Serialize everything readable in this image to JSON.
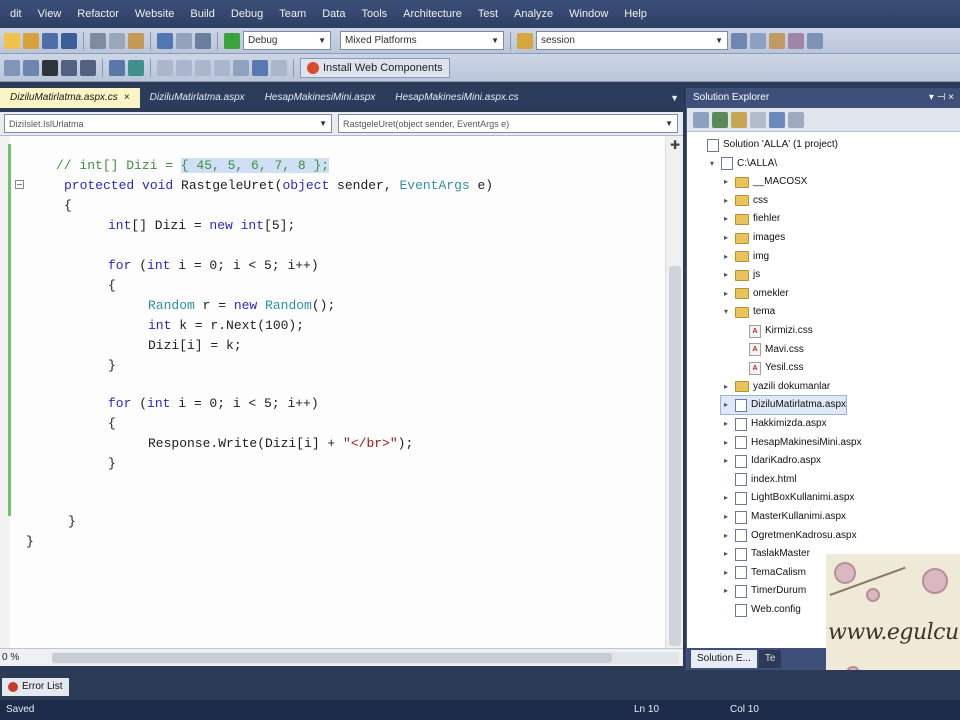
{
  "menu": [
    "dit",
    "View",
    "Refactor",
    "Website",
    "Build",
    "Debug",
    "Team",
    "Data",
    "Tools",
    "Architecture",
    "Test",
    "Analyze",
    "Window",
    "Help"
  ],
  "toolbar": {
    "config": "Debug",
    "platform": "Mixed Platforms",
    "find": "session",
    "install_web_components": "Install Web Components"
  },
  "tabs": [
    {
      "label": "DiziluMatirlatma.aspx.cs",
      "active": true
    },
    {
      "label": "DiziluMatirlatma.aspx",
      "active": false
    },
    {
      "label": "HesapMakinesiMini.aspx",
      "active": false
    },
    {
      "label": "HesapMakinesiMini.aspx.cs",
      "active": false
    }
  ],
  "navbar": {
    "class_combo": "DiziIslet.IslUrlatma",
    "method_combo": "RastgeleUret(object sender, EventArgs e)"
  },
  "code": {
    "comment_prefix": "// int[] Dizi = ",
    "comment_highlight": "{ 45, 5, 6, 7, 8 };",
    "sig_kw": "protected void",
    "sig_name": " RastgeleUret(",
    "sig_kw2": "object",
    "sig_mid": " sender, ",
    "sig_type": "EventArgs",
    "sig_end": " e)",
    "open_brace": "{",
    "close_brace": "}",
    "decl_kw": "int",
    "decl_mid": "[] Dizi = ",
    "decl_new": "new",
    "decl_int": " int",
    "decl_end": "[5];",
    "for1_kw": "for",
    "for1_open": " (",
    "for1_int": "int",
    "for1_rest": " i = 0; i < 5; i++)",
    "rand_type": "Random",
    "rand_mid": " r = ",
    "rand_new": "new",
    "rand_type2": " Random",
    "rand_end": "();",
    "next_kw": "int",
    "next_rest": " k = r.Next(100);",
    "assign": "Dizi[i] = k;",
    "for2_kw": "for",
    "for2_open": " (",
    "for2_int": "int",
    "for2_rest": " i = 0; i < 5; i++)",
    "write_pre": "Response.Write(Dizi[i] + ",
    "write_str": "\"</br>\"",
    "write_end": ");"
  },
  "editor": {
    "zoom": "0 %"
  },
  "solution_explorer": {
    "title": "Solution Explorer",
    "nodes": [
      {
        "label": "Solution 'ALLA' (1 project)",
        "icon": "solution",
        "indent": 0,
        "exp": ""
      },
      {
        "label": "C:\\ALLA\\",
        "icon": "project",
        "indent": 1,
        "exp": "▾"
      },
      {
        "label": "__MACOSX",
        "icon": "folder",
        "indent": 2,
        "exp": "▸"
      },
      {
        "label": "css",
        "icon": "folder",
        "indent": 2,
        "exp": "▸"
      },
      {
        "label": "fiehler",
        "icon": "folder",
        "indent": 2,
        "exp": "▸"
      },
      {
        "label": "images",
        "icon": "folder",
        "indent": 2,
        "exp": "▸"
      },
      {
        "label": "img",
        "icon": "folder",
        "indent": 2,
        "exp": "▸"
      },
      {
        "label": "js",
        "icon": "folder",
        "indent": 2,
        "exp": "▸"
      },
      {
        "label": "omekler",
        "icon": "folder",
        "indent": 2,
        "exp": "▸"
      },
      {
        "label": "tema",
        "icon": "folder",
        "indent": 2,
        "exp": "▾"
      },
      {
        "label": "Kirmizi.css",
        "icon": "css",
        "indent": 3,
        "exp": ""
      },
      {
        "label": "Mavi.css",
        "icon": "css",
        "indent": 3,
        "exp": ""
      },
      {
        "label": "Yesil.css",
        "icon": "css",
        "indent": 3,
        "exp": ""
      },
      {
        "label": "yazili dokumanlar",
        "icon": "folder",
        "indent": 2,
        "exp": "▸"
      },
      {
        "label": "DiziluMatirlatma.aspx",
        "icon": "page",
        "indent": 2,
        "exp": "▸",
        "selected": true
      },
      {
        "label": "Hakkimizda.aspx",
        "icon": "page",
        "indent": 2,
        "exp": "▸"
      },
      {
        "label": "HesapMakinesiMini.aspx",
        "icon": "page",
        "indent": 2,
        "exp": "▸"
      },
      {
        "label": "IdariKadro.aspx",
        "icon": "page",
        "indent": 2,
        "exp": "▸"
      },
      {
        "label": "index.html",
        "icon": "page",
        "indent": 2,
        "exp": ""
      },
      {
        "label": "LightBoxKullanimi.aspx",
        "icon": "page",
        "indent": 2,
        "exp": "▸"
      },
      {
        "label": "MasterKullanimi.aspx",
        "icon": "page",
        "indent": 2,
        "exp": "▸"
      },
      {
        "label": "OgretmenKadrosu.aspx",
        "icon": "page",
        "indent": 2,
        "exp": "▸"
      },
      {
        "label": "TaslakMaster",
        "icon": "page",
        "indent": 2,
        "exp": "▸"
      },
      {
        "label": "TemaCalism",
        "icon": "page",
        "indent": 2,
        "exp": "▸"
      },
      {
        "label": "TimerDurum",
        "icon": "page",
        "indent": 2,
        "exp": "▸"
      },
      {
        "label": "Web.config",
        "icon": "page",
        "indent": 2,
        "exp": ""
      }
    ],
    "tab_active": "Solution E...",
    "tab_other": "Te"
  },
  "watermark": "www.egulcu",
  "error_list": "Error List",
  "status": {
    "left": "Saved",
    "ln": "Ln 10",
    "col": "Col 10"
  }
}
